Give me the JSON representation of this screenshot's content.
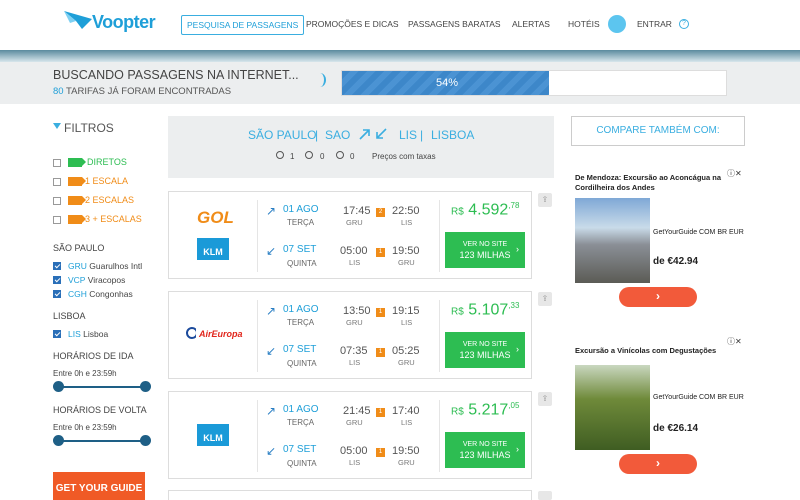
{
  "header": {
    "logo_text": "Voopter",
    "nav": [
      "PESQUISA DE PASSAGENS",
      "PROMOÇÕES E DICAS",
      "PASSAGENS BARATAS",
      "ALERTAS",
      "HOTÉIS"
    ],
    "login": "ENTRAR",
    "help": "?"
  },
  "progress": {
    "title": "BUSCANDO PASSAGENS NA INTERNET...",
    "count": "80",
    "count_suffix": "TARIFAS JÁ FORAM ENCONTRADAS",
    "percent_label": "54%",
    "percent": 54
  },
  "filters": {
    "title": "FILTROS",
    "stops": [
      {
        "label": "DIRETOS",
        "color": "#2dbd52",
        "checked": false
      },
      {
        "label": "1 ESCALA",
        "color": "#f08c18",
        "checked": false
      },
      {
        "label": "2 ESCALAS",
        "color": "#f08c18",
        "checked": false
      },
      {
        "label": "3 + ESCALAS",
        "color": "#f08c18",
        "checked": false
      }
    ],
    "origin_title": "SÃO PAULO",
    "origin_airports": [
      {
        "code": "GRU",
        "name": "Guarulhos Intl"
      },
      {
        "code": "VCP",
        "name": "Viracopos"
      },
      {
        "code": "CGH",
        "name": "Congonhas"
      }
    ],
    "dest_title": "LISBOA",
    "dest_airports": [
      {
        "code": "LIS",
        "name": "Lisboa"
      }
    ],
    "ida_title": "HORÁRIOS DE IDA",
    "ida_range": "Entre 0h e 23:59h",
    "volta_title": "HORÁRIOS DE VOLTA",
    "volta_range": "Entre 0h e 23:59h",
    "ad_label": "GET YOUR GUIDE"
  },
  "search": {
    "origin_city": "SÃO PAULO",
    "origin_code": "SAO",
    "dest_code": "LIS",
    "dest_city": "LISBOA",
    "sep": "|",
    "adults": "1",
    "children": "0",
    "infants": "0",
    "price_note": "Preços com taxas"
  },
  "results": [
    {
      "airlines": [
        "GOL",
        "KLM"
      ],
      "out": {
        "date": "01 AGO",
        "dow": "TERÇA",
        "dep": "17:45",
        "dep_ap": "GRU",
        "arr": "22:50",
        "arr_ap": "LIS",
        "stops": "2"
      },
      "ret": {
        "date": "07 SET",
        "dow": "QUINTA",
        "dep": "05:00",
        "dep_ap": "LIS",
        "arr": "19:50",
        "arr_ap": "GRU",
        "stops": "1"
      },
      "currency": "R$",
      "price": "4.592",
      "cents": ",78",
      "btn_line1": "VER NO SITE",
      "btn_line2": "123 MILHAS"
    },
    {
      "airlines": [
        "AirEuropa"
      ],
      "out": {
        "date": "01 AGO",
        "dow": "TERÇA",
        "dep": "13:50",
        "dep_ap": "GRU",
        "arr": "19:15",
        "arr_ap": "LIS",
        "stops": "1"
      },
      "ret": {
        "date": "07 SET",
        "dow": "QUINTA",
        "dep": "07:35",
        "dep_ap": "LIS",
        "arr": "05:25",
        "arr_ap": "GRU",
        "stops": "1"
      },
      "currency": "R$",
      "price": "5.107",
      "cents": ",33",
      "btn_line1": "VER NO SITE",
      "btn_line2": "123 MILHAS"
    },
    {
      "airlines": [
        "KLM"
      ],
      "out": {
        "date": "01 AGO",
        "dow": "TERÇA",
        "dep": "21:45",
        "dep_ap": "GRU",
        "arr": "17:40",
        "arr_ap": "LIS",
        "stops": "1"
      },
      "ret": {
        "date": "07 SET",
        "dow": "QUINTA",
        "dep": "05:00",
        "dep_ap": "LIS",
        "arr": "19:50",
        "arr_ap": "GRU",
        "stops": "1"
      },
      "currency": "R$",
      "price": "5.217",
      "cents": ",05",
      "btn_line1": "VER NO SITE",
      "btn_line2": "123 MILHAS"
    }
  ],
  "compare": "COMPARE TAMBÉM COM:",
  "ads": [
    {
      "title": "De Mendoza: Excursão ao Aconcágua na Cordilheira dos Andes",
      "vendor": "GetYourGuide COM BR EUR",
      "price": "de €42.94"
    },
    {
      "title": "Excursão a Vinícolas com Degustações",
      "vendor": "GetYourGuide COM BR EUR",
      "price": "de €26.14"
    }
  ]
}
